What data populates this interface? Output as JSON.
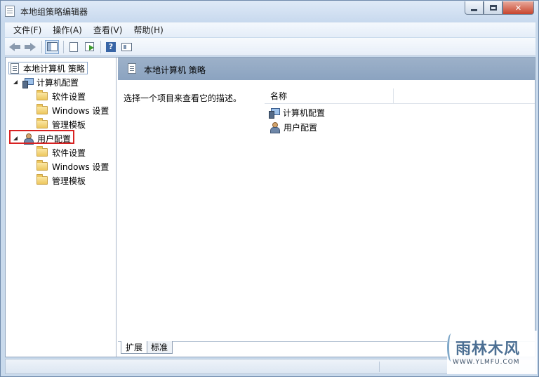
{
  "window": {
    "title": "本地组策略编辑器",
    "buttons": {
      "minimize": "",
      "maximize": "",
      "close": "✕"
    }
  },
  "menu": [
    "文件(F)",
    "操作(A)",
    "查看(V)",
    "帮助(H)"
  ],
  "toolbar": {
    "icons": [
      "back-icon",
      "forward-icon",
      "show-hide-console-tree-icon",
      "properties-icon",
      "export-list-icon",
      "help-icon",
      "show-action-pane-icon"
    ],
    "help_glyph": "?"
  },
  "tree": {
    "root": "本地计算机 策略",
    "computer_config": "计算机配置",
    "computer_children": [
      "软件设置",
      "Windows 设置",
      "管理模板"
    ],
    "user_config": "用户配置",
    "user_children": [
      "软件设置",
      "Windows 设置",
      "管理模板"
    ]
  },
  "pane": {
    "header_title": "本地计算机 策略",
    "description": "选择一个项目来查看它的描述。",
    "column_name": "名称",
    "items": [
      "计算机配置",
      "用户配置"
    ]
  },
  "tabs": [
    "扩展",
    "标准"
  ],
  "watermark": {
    "main": "雨林木风",
    "sub": "WWW.YLMFU.COM"
  },
  "colors": {
    "highlight": "#d82222",
    "header_band": "#8ba3c0",
    "frame": "#c9daec"
  }
}
